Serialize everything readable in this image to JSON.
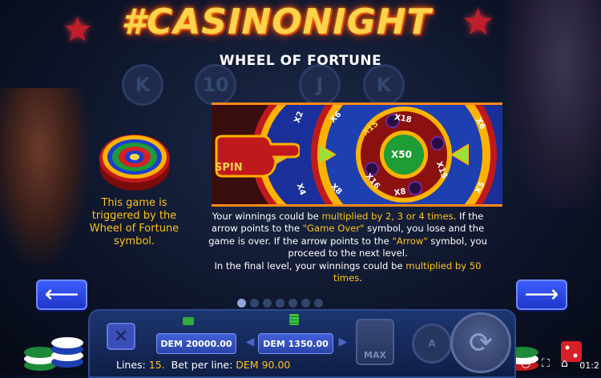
{
  "logo_text": "#CASINONIGHT",
  "title": "WHEEL OF FORTUNE",
  "background_reel_symbols": [
    "K",
    "10",
    "J",
    "K"
  ],
  "trigger_text": "This game is triggered by the Wheel of Fortune symbol.",
  "wheel": {
    "spin_label": "SPIN",
    "center_label": "X50",
    "outer_labels": [
      "X2",
      "X4",
      "X6",
      "X8"
    ],
    "middle_labels": [
      "X15",
      "X18",
      "X15",
      "X16",
      "X8"
    ],
    "right_labels": [
      "X6",
      "X5"
    ]
  },
  "description": {
    "p1_a": "Your winnings could be ",
    "p1_hl": "multiplied by 2, 3 or 4 times",
    "p1_b": ". If the arrow points to the ",
    "p1_hl2": "\"Game Over\"",
    "p1_c": " symbol, you lose and the game is over. If the arrow points to the ",
    "p1_hl3": "\"Arrow\"",
    "p1_d": " symbol, you proceed to the next level.",
    "p2_a": "In the final level, your winnings could be ",
    "p2_hl": "multiplied by 50 times",
    "p2_b": "."
  },
  "pager": {
    "count": 7,
    "active_index": 0
  },
  "bottom_bar": {
    "balance": "DEM 20000.00",
    "bet": "DEM 1350.00",
    "max_label": "MAX",
    "auto_label": "A",
    "lines_label": "Lines:",
    "lines_value": "15.",
    "bet_per_line_label": "Bet per line:",
    "bet_per_line_value": "DEM 90.00"
  },
  "system_bar": {
    "clock": "01:2"
  },
  "colors": {
    "highlight": "#ffc21a",
    "button_blue": "#2f4ae0",
    "logo": "#ffd34a"
  }
}
